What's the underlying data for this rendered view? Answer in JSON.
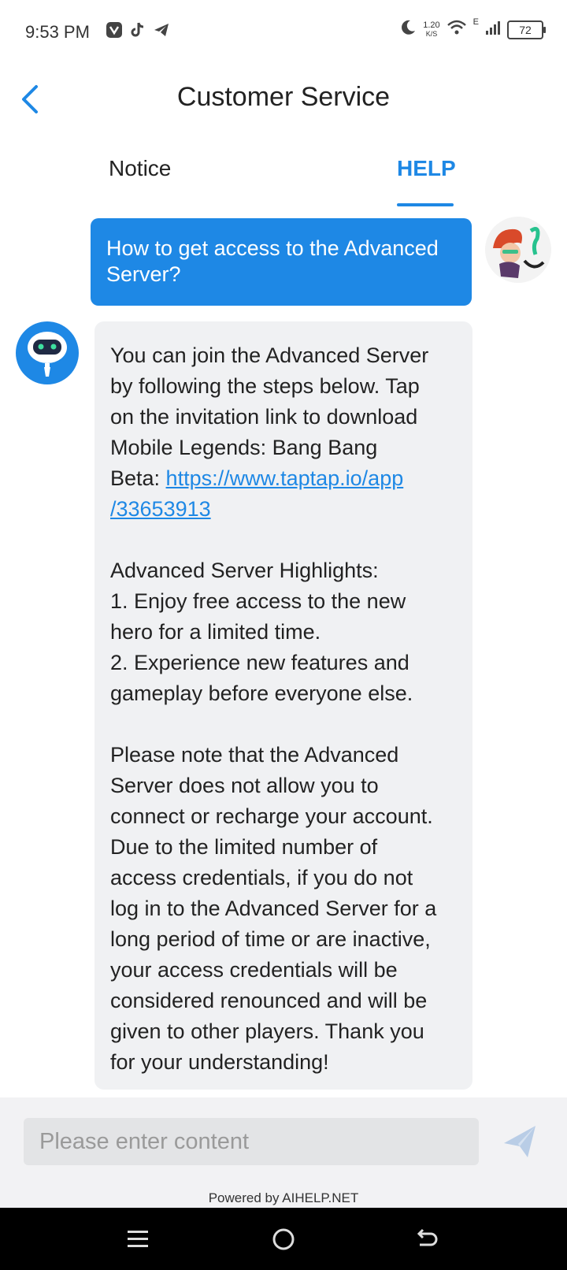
{
  "status_bar": {
    "time": "9:53 PM",
    "speed_value": "1.20",
    "speed_unit": "K/S",
    "network": "E",
    "battery": "72",
    "apps": [
      "messenger-icon",
      "tiktok-icon",
      "telegram-icon"
    ]
  },
  "header": {
    "title": "Customer Service",
    "back_icon": "chevron-left-icon"
  },
  "tabs": [
    {
      "label": "Notice",
      "active": false
    },
    {
      "label": "HELP",
      "active": true
    }
  ],
  "conversation": {
    "user_message": "How to get access to the Advanced Server?",
    "bot_message": {
      "intro_lines": [
        "You can join the Advanced Server",
        "by following the steps below. Tap",
        "on the invitation link to download",
        "Mobile Legends: Bang Bang"
      ],
      "link_prefix": "Beta: ",
      "link_line1": "https://www.taptap.io/app",
      "link_line2": "/33653913",
      "highlights_title": "Advanced Server Highlights:",
      "highlights_lines": [
        "1. Enjoy free access to the new",
        "hero for a limited time.",
        "2. Experience new features and",
        "gameplay before everyone else."
      ],
      "note_lines": [
        "Please note that the Advanced",
        "Server does not allow you to",
        "connect or recharge your account.",
        "Due to the limited number of",
        "access credentials, if you do not",
        "log in to the Advanced Server for a",
        "long period of time or are inactive,",
        "your access credentials will be",
        "considered renounced and will be",
        "given to other players. Thank you",
        "for your understanding!"
      ]
    }
  },
  "input": {
    "placeholder": "Please enter content",
    "value": ""
  },
  "footer": {
    "powered_by": "Powered by AIHELP.NET"
  },
  "colors": {
    "accent": "#1e88e5",
    "bot_bubble": "#f0f1f3",
    "input_bg": "#e3e4e6"
  }
}
